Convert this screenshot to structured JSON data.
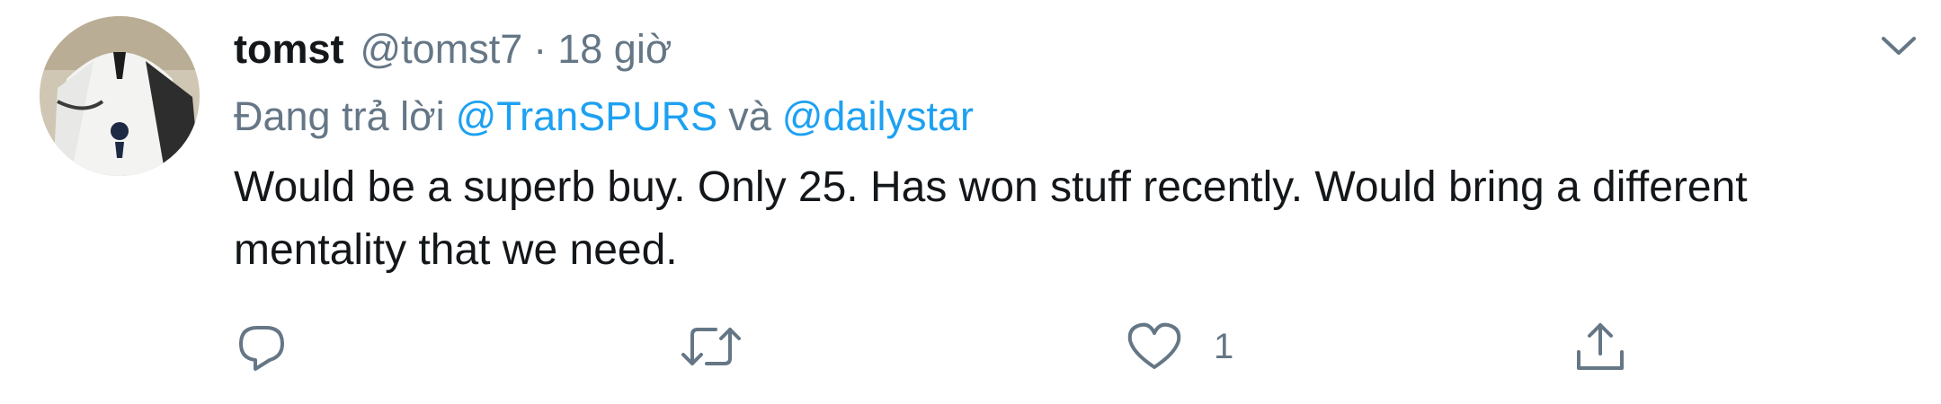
{
  "tweet": {
    "author_name": "tomst",
    "author_handle": "@tomst7",
    "separator": "·",
    "time": "18 giờ",
    "reply_prefix": "Đang trả lời",
    "mentions": [
      "@TranSPURS",
      "@dailystar"
    ],
    "mention_joiner": "và",
    "text": "Would be a superb buy. Only 25. Has won stuff recently. Would bring a different mentality that we need.",
    "like_count": "1"
  },
  "icons": {
    "caret": "chevron-down-icon",
    "reply": "reply-icon",
    "retweet": "retweet-icon",
    "like": "heart-icon",
    "share": "share-icon"
  },
  "colors": {
    "text": "#14171a",
    "secondary": "#657786",
    "link": "#1da1f2"
  }
}
